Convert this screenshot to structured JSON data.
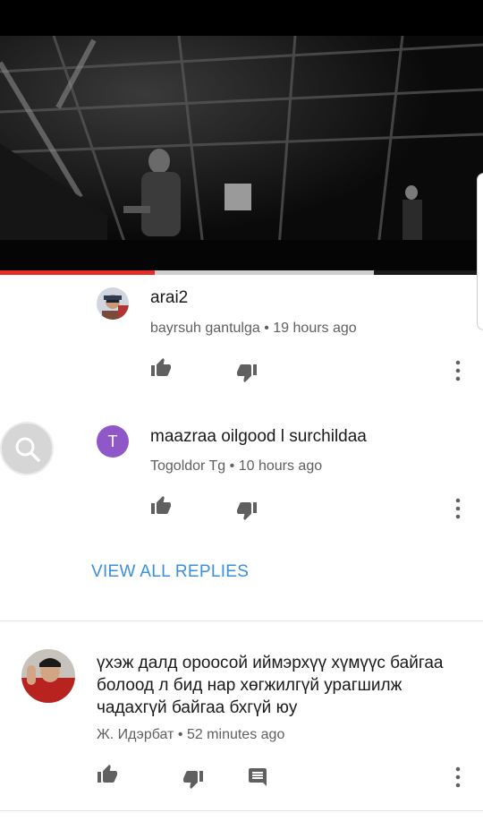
{
  "video": {
    "progress": 0.32
  },
  "comments": [
    {
      "text": "arai2",
      "author": "bayrsuh gantulga",
      "time": "19 hours ago"
    },
    {
      "text": "maazraa oilgood l surchildaa",
      "author": "Togoldor Tg",
      "time": "10 hours ago",
      "avatar_letter": "T",
      "avatar_color": "#8f57c8"
    },
    {
      "text": "үхэж далд ороосой иймэрхүү хүмүүс байгаа болоод л бид нар хөгжилгүй урагшилж чадахгүй байгаа бхгүй юу",
      "author": "Ж. Идэрбат",
      "time": "52 minutes ago"
    }
  ],
  "separator": "•",
  "replies": {
    "view_all_label": "VIEW ALL REPLIES"
  },
  "colors": {
    "accent": "#3a8fe0",
    "progress": "#e52d27"
  },
  "icons": [
    "thumb-up-icon",
    "thumb-down-icon",
    "reply-icon",
    "more-vert-icon",
    "search-icon"
  ]
}
